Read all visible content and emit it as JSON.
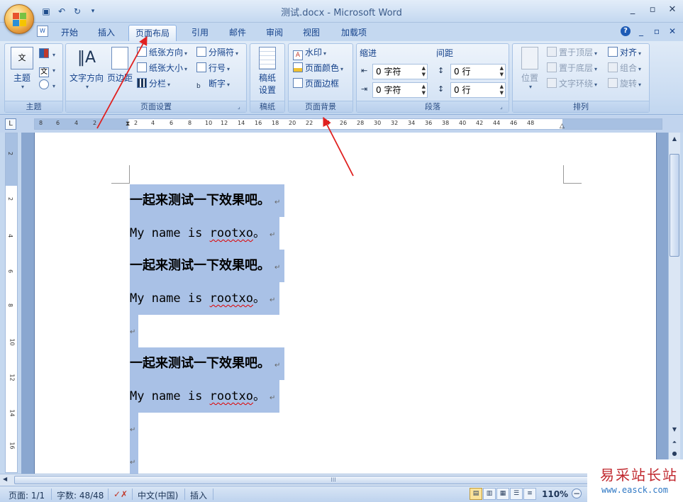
{
  "window": {
    "title": "测试.docx - Microsoft Word",
    "controls": [
      "minimize",
      "restore",
      "close"
    ]
  },
  "quick_access": [
    {
      "name": "save",
      "icon": "save-icon"
    },
    {
      "name": "undo",
      "icon": "undo-icon"
    },
    {
      "name": "redo",
      "icon": "redo-icon"
    },
    {
      "name": "customize",
      "icon": "chevron-down-icon"
    }
  ],
  "tabs": [
    "开始",
    "插入",
    "页面布局",
    "引用",
    "邮件",
    "审阅",
    "视图",
    "加载项"
  ],
  "active_tab": "页面布局",
  "ribbon": {
    "theme": {
      "label": "主题",
      "button": "主题"
    },
    "page_setup": {
      "label": "页面设置",
      "text_direction": "文字方向",
      "margins": "页边距",
      "orientation": "纸张方向",
      "size": "纸张大小",
      "columns": "分栏",
      "breaks": "分隔符",
      "line_numbers": "行号",
      "hyphenation": "断字"
    },
    "draft": {
      "label": "稿纸",
      "button_line1": "稿纸",
      "button_line2": "设置"
    },
    "page_background": {
      "label": "页面背景",
      "watermark": "水印",
      "page_color": "页面颜色",
      "page_borders": "页面边框"
    },
    "paragraph": {
      "label": "段落",
      "indent_label": "缩进",
      "spacing_label": "间距",
      "indent_left": "0 字符",
      "indent_right": "0 字符",
      "spacing_before": "0 行",
      "spacing_after": "0 行"
    },
    "arrange": {
      "label": "排列",
      "position": "位置",
      "bring_front": "置于顶层",
      "send_back": "置于底层",
      "text_wrap": "文字环绕",
      "align": "对齐",
      "group": "组合",
      "rotate": "旋转"
    }
  },
  "ruler": {
    "corner": "L",
    "numbers": [
      "8",
      "6",
      "4",
      "2",
      "2",
      "4",
      "6",
      "8",
      "10",
      "12",
      "14",
      "16",
      "18",
      "20",
      "22",
      "24",
      "26",
      "28",
      "30",
      "32",
      "34",
      "36",
      "38",
      "40",
      "42",
      "44",
      "46",
      "48"
    ],
    "vnumbers": [
      "2",
      "2",
      "4",
      "6",
      "8",
      "10",
      "12",
      "14",
      "16"
    ]
  },
  "document": {
    "lines": [
      {
        "type": "cn",
        "text": "一起来测试一下效果吧。"
      },
      {
        "type": "en",
        "pre": "My name is ",
        "word": "rootxo",
        "post": "。"
      },
      {
        "type": "cn",
        "text": "一起来测试一下效果吧。"
      },
      {
        "type": "en",
        "pre": "My name is ",
        "word": "rootxo",
        "post": "。"
      },
      {
        "type": "empty"
      },
      {
        "type": "cn",
        "text": "一起来测试一下效果吧。"
      },
      {
        "type": "en",
        "pre": "My name is ",
        "word": "rootxo",
        "post": "。"
      },
      {
        "type": "empty"
      },
      {
        "type": "empty"
      }
    ],
    "para_mark": "↵",
    "selection_color": "#a9c1e6"
  },
  "status": {
    "page": "页面: 1/1",
    "words": "字数: 48/48",
    "language": "中文(中国)",
    "mode": "插入",
    "zoom": "110%"
  },
  "watermark": {
    "line1": "易采站长站",
    "line2": "www.easck.com"
  },
  "colors": {
    "accent": "#15428b",
    "arrow": "#e0201f",
    "selection": "#a9c1e6"
  }
}
